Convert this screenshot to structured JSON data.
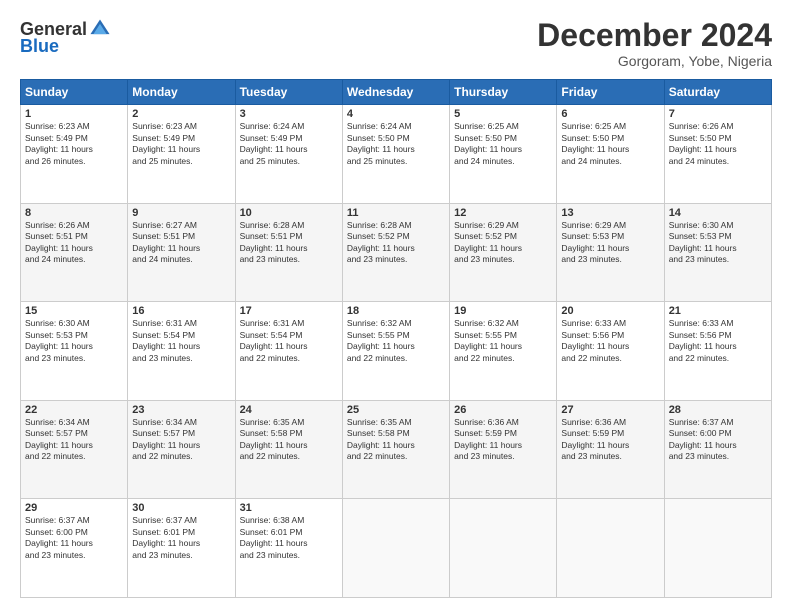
{
  "logo": {
    "general": "General",
    "blue": "Blue"
  },
  "header": {
    "month": "December 2024",
    "location": "Gorgoram, Yobe, Nigeria"
  },
  "weekdays": [
    "Sunday",
    "Monday",
    "Tuesday",
    "Wednesday",
    "Thursday",
    "Friday",
    "Saturday"
  ],
  "weeks": [
    [
      {
        "day": "1",
        "info": "Sunrise: 6:23 AM\nSunset: 5:49 PM\nDaylight: 11 hours\nand 26 minutes."
      },
      {
        "day": "2",
        "info": "Sunrise: 6:23 AM\nSunset: 5:49 PM\nDaylight: 11 hours\nand 25 minutes."
      },
      {
        "day": "3",
        "info": "Sunrise: 6:24 AM\nSunset: 5:49 PM\nDaylight: 11 hours\nand 25 minutes."
      },
      {
        "day": "4",
        "info": "Sunrise: 6:24 AM\nSunset: 5:50 PM\nDaylight: 11 hours\nand 25 minutes."
      },
      {
        "day": "5",
        "info": "Sunrise: 6:25 AM\nSunset: 5:50 PM\nDaylight: 11 hours\nand 24 minutes."
      },
      {
        "day": "6",
        "info": "Sunrise: 6:25 AM\nSunset: 5:50 PM\nDaylight: 11 hours\nand 24 minutes."
      },
      {
        "day": "7",
        "info": "Sunrise: 6:26 AM\nSunset: 5:50 PM\nDaylight: 11 hours\nand 24 minutes."
      }
    ],
    [
      {
        "day": "8",
        "info": "Sunrise: 6:26 AM\nSunset: 5:51 PM\nDaylight: 11 hours\nand 24 minutes."
      },
      {
        "day": "9",
        "info": "Sunrise: 6:27 AM\nSunset: 5:51 PM\nDaylight: 11 hours\nand 24 minutes."
      },
      {
        "day": "10",
        "info": "Sunrise: 6:28 AM\nSunset: 5:51 PM\nDaylight: 11 hours\nand 23 minutes."
      },
      {
        "day": "11",
        "info": "Sunrise: 6:28 AM\nSunset: 5:52 PM\nDaylight: 11 hours\nand 23 minutes."
      },
      {
        "day": "12",
        "info": "Sunrise: 6:29 AM\nSunset: 5:52 PM\nDaylight: 11 hours\nand 23 minutes."
      },
      {
        "day": "13",
        "info": "Sunrise: 6:29 AM\nSunset: 5:53 PM\nDaylight: 11 hours\nand 23 minutes."
      },
      {
        "day": "14",
        "info": "Sunrise: 6:30 AM\nSunset: 5:53 PM\nDaylight: 11 hours\nand 23 minutes."
      }
    ],
    [
      {
        "day": "15",
        "info": "Sunrise: 6:30 AM\nSunset: 5:53 PM\nDaylight: 11 hours\nand 23 minutes."
      },
      {
        "day": "16",
        "info": "Sunrise: 6:31 AM\nSunset: 5:54 PM\nDaylight: 11 hours\nand 23 minutes."
      },
      {
        "day": "17",
        "info": "Sunrise: 6:31 AM\nSunset: 5:54 PM\nDaylight: 11 hours\nand 22 minutes."
      },
      {
        "day": "18",
        "info": "Sunrise: 6:32 AM\nSunset: 5:55 PM\nDaylight: 11 hours\nand 22 minutes."
      },
      {
        "day": "19",
        "info": "Sunrise: 6:32 AM\nSunset: 5:55 PM\nDaylight: 11 hours\nand 22 minutes."
      },
      {
        "day": "20",
        "info": "Sunrise: 6:33 AM\nSunset: 5:56 PM\nDaylight: 11 hours\nand 22 minutes."
      },
      {
        "day": "21",
        "info": "Sunrise: 6:33 AM\nSunset: 5:56 PM\nDaylight: 11 hours\nand 22 minutes."
      }
    ],
    [
      {
        "day": "22",
        "info": "Sunrise: 6:34 AM\nSunset: 5:57 PM\nDaylight: 11 hours\nand 22 minutes."
      },
      {
        "day": "23",
        "info": "Sunrise: 6:34 AM\nSunset: 5:57 PM\nDaylight: 11 hours\nand 22 minutes."
      },
      {
        "day": "24",
        "info": "Sunrise: 6:35 AM\nSunset: 5:58 PM\nDaylight: 11 hours\nand 22 minutes."
      },
      {
        "day": "25",
        "info": "Sunrise: 6:35 AM\nSunset: 5:58 PM\nDaylight: 11 hours\nand 22 minutes."
      },
      {
        "day": "26",
        "info": "Sunrise: 6:36 AM\nSunset: 5:59 PM\nDaylight: 11 hours\nand 23 minutes."
      },
      {
        "day": "27",
        "info": "Sunrise: 6:36 AM\nSunset: 5:59 PM\nDaylight: 11 hours\nand 23 minutes."
      },
      {
        "day": "28",
        "info": "Sunrise: 6:37 AM\nSunset: 6:00 PM\nDaylight: 11 hours\nand 23 minutes."
      }
    ],
    [
      {
        "day": "29",
        "info": "Sunrise: 6:37 AM\nSunset: 6:00 PM\nDaylight: 11 hours\nand 23 minutes."
      },
      {
        "day": "30",
        "info": "Sunrise: 6:37 AM\nSunset: 6:01 PM\nDaylight: 11 hours\nand 23 minutes."
      },
      {
        "day": "31",
        "info": "Sunrise: 6:38 AM\nSunset: 6:01 PM\nDaylight: 11 hours\nand 23 minutes."
      },
      null,
      null,
      null,
      null
    ]
  ]
}
